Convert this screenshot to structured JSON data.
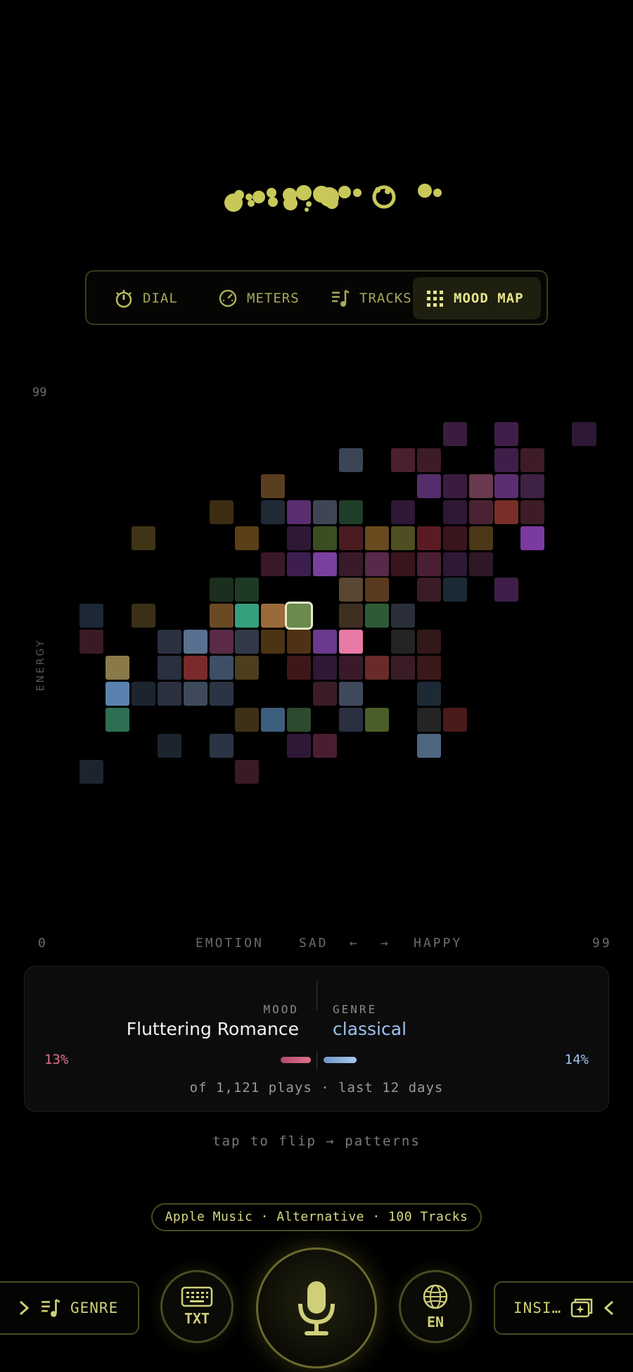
{
  "tabs": [
    {
      "label": "DIAL",
      "icon": "dial-icon",
      "active": false
    },
    {
      "label": "METERS",
      "icon": "gauge-icon",
      "active": false
    },
    {
      "label": "TRACKS",
      "icon": "music-list-icon",
      "active": false
    },
    {
      "label": "MOOD MAP",
      "icon": "grid-icon",
      "active": true
    }
  ],
  "mood_map": {
    "y_max_label": "99",
    "y_axis_label": "ENERGY",
    "x_min_label": "0",
    "x_max_label": "99",
    "x_axis_label": "EMOTION",
    "x_left_word": "SAD",
    "x_right_word": "HAPPY",
    "arrow_left": "←",
    "arrow_right": "→",
    "cells": [
      [
        14,
        0,
        "#3a1c3e"
      ],
      [
        16,
        0,
        "#3f1f4a"
      ],
      [
        19,
        0,
        "#2e1836"
      ],
      [
        10,
        1,
        "#3a4656"
      ],
      [
        12,
        1,
        "#4a1f30"
      ],
      [
        13,
        1,
        "#3d1c26"
      ],
      [
        16,
        1,
        "#3f1f4a"
      ],
      [
        17,
        1,
        "#3d1c26"
      ],
      [
        7,
        2,
        "#5a3e20"
      ],
      [
        13,
        2,
        "#542e6c"
      ],
      [
        14,
        2,
        "#3a1c3e"
      ],
      [
        15,
        2,
        "#6a3a4e"
      ],
      [
        16,
        2,
        "#5a2e70"
      ],
      [
        17,
        2,
        "#3d2244"
      ],
      [
        5,
        3,
        "#3c2c12"
      ],
      [
        7,
        3,
        "#1f2a36"
      ],
      [
        8,
        3,
        "#5a2e70"
      ],
      [
        9,
        3,
        "#3e4656"
      ],
      [
        10,
        3,
        "#1f3e2a"
      ],
      [
        12,
        3,
        "#2e1836"
      ],
      [
        14,
        3,
        "#2e1836"
      ],
      [
        15,
        3,
        "#4a2233"
      ],
      [
        16,
        3,
        "#7a2e2a"
      ],
      [
        17,
        3,
        "#3d1c26"
      ],
      [
        2,
        4,
        "#3e3416"
      ],
      [
        6,
        4,
        "#5a3e16"
      ],
      [
        8,
        4,
        "#2e1836"
      ],
      [
        9,
        4,
        "#3a4e22"
      ],
      [
        10,
        4,
        "#4a1c22"
      ],
      [
        11,
        4,
        "#6a4a1e"
      ],
      [
        12,
        4,
        "#4e4e22"
      ],
      [
        13,
        4,
        "#5a1c22"
      ],
      [
        14,
        4,
        "#3a141c"
      ],
      [
        15,
        4,
        "#4a3816"
      ],
      [
        17,
        4,
        "#7a3aa0"
      ],
      [
        7,
        5,
        "#3a1828"
      ],
      [
        8,
        5,
        "#3e1e50"
      ],
      [
        9,
        5,
        "#7a40a0"
      ],
      [
        10,
        5,
        "#3a1a2a"
      ],
      [
        11,
        5,
        "#5a2848"
      ],
      [
        12,
        5,
        "#3a141c"
      ],
      [
        13,
        5,
        "#4a1e34"
      ],
      [
        14,
        5,
        "#2e1836"
      ],
      [
        15,
        5,
        "#2e1828"
      ],
      [
        5,
        6,
        "#1c2e1c"
      ],
      [
        6,
        6,
        "#1f3a24"
      ],
      [
        10,
        6,
        "#5a4632"
      ],
      [
        11,
        6,
        "#5a3a1e"
      ],
      [
        13,
        6,
        "#3a1c28"
      ],
      [
        14,
        6,
        "#1c2a36"
      ],
      [
        16,
        6,
        "#3f1f4a"
      ],
      [
        0,
        7,
        "#1c2836"
      ],
      [
        2,
        7,
        "#3a3016"
      ],
      [
        5,
        7,
        "#6a4a24"
      ],
      [
        6,
        7,
        "#36a07c"
      ],
      [
        7,
        7,
        "#9a6a3a"
      ],
      [
        8,
        7,
        "#6a8a4e"
      ],
      [
        10,
        7,
        "#3e3020"
      ],
      [
        11,
        7,
        "#2e5a36"
      ],
      [
        12,
        7,
        "#2a2e3a"
      ],
      [
        0,
        8,
        "#3a1a26"
      ],
      [
        3,
        8,
        "#2a3040"
      ],
      [
        4,
        8,
        "#5a7090"
      ],
      [
        5,
        8,
        "#5a2a48"
      ],
      [
        6,
        8,
        "#323a4a"
      ],
      [
        7,
        8,
        "#4a3414"
      ],
      [
        8,
        8,
        "#4e3216"
      ],
      [
        9,
        8,
        "#6a3a8e"
      ],
      [
        10,
        8,
        "#e87aa8"
      ],
      [
        12,
        8,
        "#242424"
      ],
      [
        13,
        8,
        "#321818"
      ],
      [
        1,
        9,
        "#8a7a4a"
      ],
      [
        3,
        9,
        "#2a3040"
      ],
      [
        4,
        9,
        "#7a2a2a"
      ],
      [
        5,
        9,
        "#3e4e66"
      ],
      [
        6,
        9,
        "#4e3e1e"
      ],
      [
        8,
        9,
        "#3e1818"
      ],
      [
        9,
        9,
        "#2e1836"
      ],
      [
        10,
        9,
        "#3a1a2a"
      ],
      [
        11,
        9,
        "#6a2a2a"
      ],
      [
        12,
        9,
        "#3a1c28"
      ],
      [
        13,
        9,
        "#3a1818"
      ],
      [
        1,
        10,
        "#5a82ae"
      ],
      [
        2,
        10,
        "#1c2430"
      ],
      [
        3,
        10,
        "#2a3040"
      ],
      [
        4,
        10,
        "#3e4a5c"
      ],
      [
        5,
        10,
        "#2a3444"
      ],
      [
        9,
        10,
        "#3a1c28"
      ],
      [
        10,
        10,
        "#3e4a5c"
      ],
      [
        13,
        10,
        "#1c2a36"
      ],
      [
        1,
        11,
        "#2e6e52"
      ],
      [
        6,
        11,
        "#3e3016"
      ],
      [
        7,
        11,
        "#3e5e7e"
      ],
      [
        8,
        11,
        "#2e4a2e"
      ],
      [
        10,
        11,
        "#2a3040"
      ],
      [
        11,
        11,
        "#4a5e2a"
      ],
      [
        13,
        11,
        "#242424"
      ],
      [
        14,
        11,
        "#4a1a1a"
      ],
      [
        3,
        12,
        "#1c2430"
      ],
      [
        5,
        12,
        "#2a3444"
      ],
      [
        8,
        12,
        "#2e1836"
      ],
      [
        9,
        12,
        "#4a1e30"
      ],
      [
        13,
        12,
        "#4e6680"
      ],
      [
        0,
        13,
        "#1c2430"
      ],
      [
        6,
        13,
        "#3a1a26"
      ]
    ],
    "selected_cell": [
      8,
      7
    ]
  },
  "info_card": {
    "mood_label": "MOOD",
    "mood_value": "Fluttering Romance",
    "genre_label": "GENRE",
    "genre_value": "classical",
    "mood_pct": "13%",
    "genre_pct": "14%",
    "mood_fraction": 0.13,
    "genre_fraction": 0.14,
    "plays_text": "of 1,121 plays · last 12 days"
  },
  "flip_hint": "tap to flip → patterns",
  "source_pill": "Apple Music · Alternative · 100 Tracks",
  "bottom_bar": {
    "left_label": "GENRE",
    "txt_label": "TXT",
    "lang_label": "EN",
    "right_label": "INSI…"
  },
  "colors": {
    "accent": "#cfcf7a",
    "mood_pink": "#e0708e",
    "genre_blue": "#9cc0ee",
    "background": "#000000"
  }
}
